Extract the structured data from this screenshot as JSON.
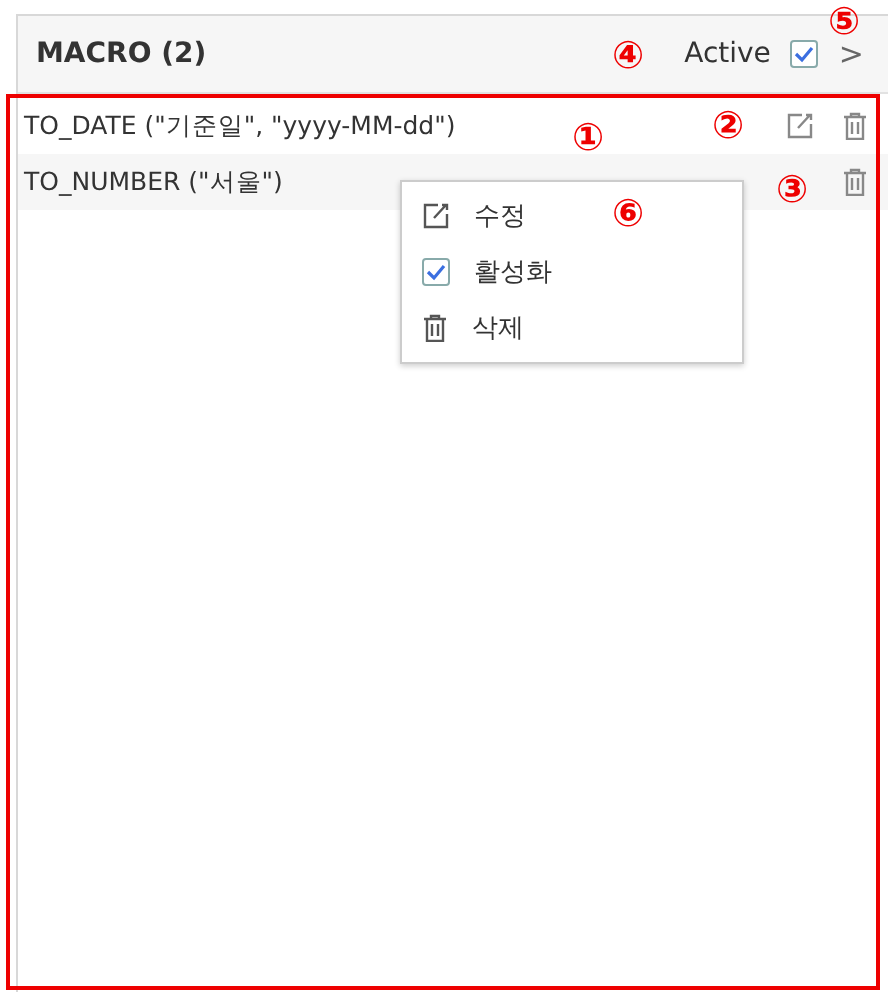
{
  "header": {
    "title": "MACRO (2)",
    "active_label": "Active",
    "active_checked": true,
    "expand_glyph": ">"
  },
  "macros": [
    {
      "text": "TO_DATE (\"기준일\", \"yyyy-MM-dd\")",
      "editable": true
    },
    {
      "text": "TO_NUMBER (\"서울\")",
      "editable": false
    }
  ],
  "context_menu": [
    {
      "kind": "edit",
      "label": "수정"
    },
    {
      "kind": "toggle",
      "label": "활성화",
      "checked": true
    },
    {
      "kind": "delete",
      "label": "삭제"
    }
  ],
  "callouts": [
    "①",
    "②",
    "③",
    "④",
    "⑤",
    "⑥"
  ]
}
